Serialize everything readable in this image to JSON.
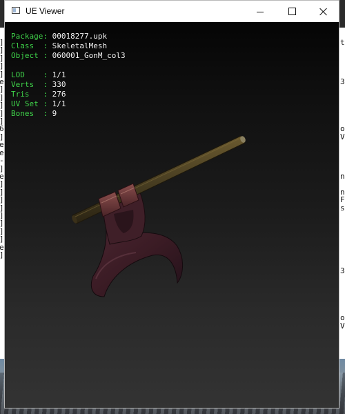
{
  "window": {
    "title": "UE Viewer"
  },
  "mesh_info": {
    "package": {
      "key": "Package: ",
      "value": "00018277.upk"
    },
    "class": {
      "key": "Class  : ",
      "value": "SkeletalMesh"
    },
    "object": {
      "key": "Object : ",
      "value": "060001_GonM_col3"
    },
    "lod": {
      "key": "LOD    : ",
      "value": "1/1"
    },
    "verts": {
      "key": "Verts  : ",
      "value": "330"
    },
    "tris": {
      "key": "Tris   : ",
      "value": "276"
    },
    "uvset": {
      "key": "UV Set : ",
      "value": "1/1"
    },
    "bones": {
      "key": "Bones  : ",
      "value": "9"
    }
  },
  "background": {
    "left_console_glyphs": "]\n]\n]\n]\n]\ne\n]\n]\n]\n]\n]\n6\n]\ne\ne\n-\n]\ne\n]\n]\n]\n]\n]\n]\n]\n]\ne\n]",
    "right_console_glyphs": "t\n\n\n\n\n3\n\n\n\n\n\no\nV\n\n\n\n\nn\n\nn\nF\ns\n\n\n\n\n\n\n\n3\n\n\n\n\n\no\nV"
  },
  "colors": {
    "label_green": "#3fd44a",
    "value_white": "#f2f2f2"
  },
  "icons": {
    "app": "app-window-icon",
    "minimize": "minimize-icon",
    "maximize": "maximize-icon",
    "close": "close-icon"
  }
}
